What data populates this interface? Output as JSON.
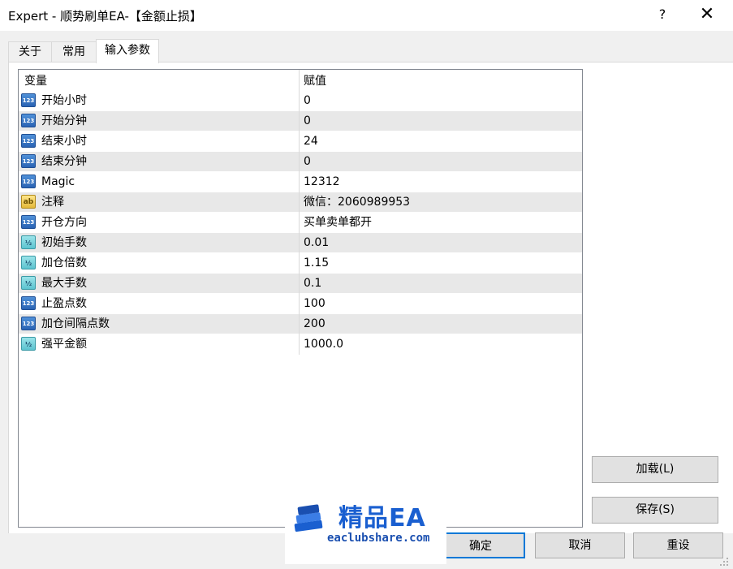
{
  "window": {
    "title": "Expert - 顺势刷单EA-【金额止损】",
    "help": "?",
    "close": "✕"
  },
  "tabs": [
    {
      "label": "关于"
    },
    {
      "label": "常用"
    },
    {
      "label": "输入参数"
    }
  ],
  "grid": {
    "headers": {
      "variable": "变量",
      "value": "赋值"
    },
    "rows": [
      {
        "type": "int",
        "icon": "123",
        "name": "开始小时",
        "value": "0"
      },
      {
        "type": "int",
        "icon": "123",
        "name": "开始分钟",
        "value": "0"
      },
      {
        "type": "int",
        "icon": "123",
        "name": "结束小时",
        "value": "24"
      },
      {
        "type": "int",
        "icon": "123",
        "name": "结束分钟",
        "value": "0"
      },
      {
        "type": "int",
        "icon": "123",
        "name": "Magic",
        "value": "12312"
      },
      {
        "type": "str",
        "icon": "ab",
        "name": "注释",
        "value": "微信：2060989953"
      },
      {
        "type": "int",
        "icon": "123",
        "name": "开仓方向",
        "value": "买单卖单都开"
      },
      {
        "type": "dbl",
        "icon": "½",
        "name": "初始手数",
        "value": "0.01"
      },
      {
        "type": "dbl",
        "icon": "½",
        "name": "加仓倍数",
        "value": "1.15"
      },
      {
        "type": "dbl",
        "icon": "½",
        "name": "最大手数",
        "value": "0.1"
      },
      {
        "type": "int",
        "icon": "123",
        "name": "止盈点数",
        "value": "100"
      },
      {
        "type": "int",
        "icon": "123",
        "name": "加仓间隔点数",
        "value": "200"
      },
      {
        "type": "dbl",
        "icon": "½",
        "name": "强平金额",
        "value": "1000.0"
      }
    ]
  },
  "buttons": {
    "load": "加载(L)",
    "save": "保存(S)",
    "ok": "确定",
    "cancel": "取消",
    "reset": "重设"
  },
  "watermark": {
    "title": "精品EA",
    "url": "eaclubshare.com"
  },
  "colors": {
    "accent": "#0078d7",
    "row_alt": "#e8e8e8",
    "watermark_blue": "#1a5fd0"
  }
}
